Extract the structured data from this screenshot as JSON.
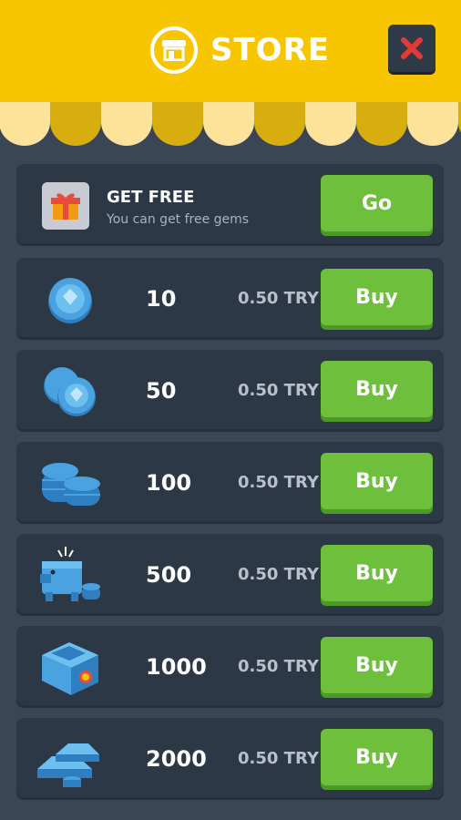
{
  "header": {
    "title": "STORE",
    "store_icon": "storefront-icon",
    "close_icon": "close-x-icon",
    "background_color": "#f7c600",
    "close_icon_color": "#e53935"
  },
  "free_offer": {
    "title": "GET FREE",
    "subtitle": "You can get free gems",
    "button_label": "Go",
    "icon": "gift-icon"
  },
  "packages": [
    {
      "amount": "10",
      "price": "0.50 TRY",
      "button_label": "Buy",
      "icon": "single-gem-coin-icon"
    },
    {
      "amount": "50",
      "price": "0.50 TRY",
      "button_label": "Buy",
      "icon": "two-gem-coins-icon"
    },
    {
      "amount": "100",
      "price": "0.50 TRY",
      "button_label": "Buy",
      "icon": "coin-stacks-icon"
    },
    {
      "amount": "500",
      "price": "0.50 TRY",
      "button_label": "Buy",
      "icon": "piggy-bank-icon"
    },
    {
      "amount": "1000",
      "price": "0.50 TRY",
      "button_label": "Buy",
      "icon": "treasure-box-icon"
    },
    {
      "amount": "2000",
      "price": "0.50 TRY",
      "button_label": "Buy",
      "icon": "gold-bars-icon"
    }
  ],
  "colors": {
    "background": "#3a4555",
    "row": "#2d3847",
    "button": "#6dbf3c",
    "gem_blue": "#4aa3e0"
  }
}
